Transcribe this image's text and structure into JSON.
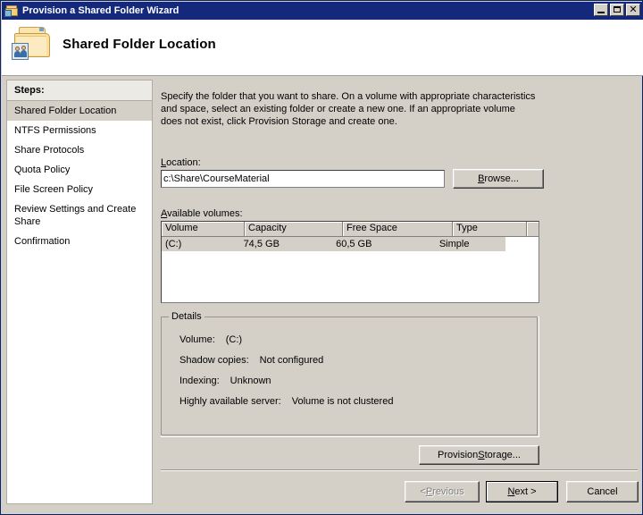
{
  "window": {
    "title": "Provision a Shared Folder Wizard",
    "icon": "shared-folder-icon",
    "controls": {
      "minimize": "_",
      "maximize": "□",
      "close": "✕"
    }
  },
  "header": {
    "title": "Shared Folder Location",
    "icon": "shared-folder-large-icon"
  },
  "sidebar": {
    "heading": "Steps:",
    "items": [
      {
        "label": "Shared Folder Location",
        "current": true
      },
      {
        "label": "NTFS Permissions",
        "current": false
      },
      {
        "label": "Share Protocols",
        "current": false
      },
      {
        "label": "Quota Policy",
        "current": false
      },
      {
        "label": "File Screen Policy",
        "current": false
      },
      {
        "label": "Review Settings and Create Share",
        "current": false
      },
      {
        "label": "Confirmation",
        "current": false
      }
    ]
  },
  "main": {
    "intro": "Specify the folder that you want to share. On a volume with appropriate characteristics and space, select an existing folder or create a new one. If an appropriate volume does not exist, click Provision Storage and create one.",
    "location": {
      "label_prefix": "",
      "label_accel": "L",
      "label_rest": "ocation:",
      "value": "c:\\Share\\CourseMaterial",
      "placeholder": ""
    },
    "browse_button": {
      "prefix": "",
      "accel": "B",
      "rest": "rowse..."
    },
    "volumes": {
      "label_accel": "A",
      "label_rest": "vailable volumes:",
      "columns": [
        "Volume",
        "Capacity",
        "Free Space",
        "Type",
        ""
      ],
      "rows": [
        {
          "cells": [
            "(C:)",
            "74,5 GB",
            "60,5 GB",
            "Simple"
          ],
          "selected": true
        }
      ]
    },
    "details": {
      "legend": "Details",
      "rows": [
        {
          "label": "Volume:",
          "value": "(C:)"
        },
        {
          "label": "Shadow copies:",
          "value": "Not configured"
        },
        {
          "label": "Indexing:",
          "value": "Unknown"
        },
        {
          "label": "Highly available server:",
          "value": "Volume is not clustered"
        }
      ]
    },
    "provision_button": {
      "prefix": "Provision ",
      "accel": "S",
      "rest": "torage..."
    }
  },
  "footer": {
    "previous": {
      "prefix": "< ",
      "accel": "P",
      "rest": "revious",
      "disabled": true
    },
    "next": {
      "prefix": "",
      "accel": "N",
      "rest": "ext >",
      "default": true
    },
    "cancel": {
      "label": "Cancel"
    }
  },
  "colors": {
    "titlebar": "#15297c",
    "dialog_face": "#d4d0c8",
    "selection_inactive": "#d4d0c8",
    "text": "#000000",
    "disabled_text": "#808080"
  }
}
